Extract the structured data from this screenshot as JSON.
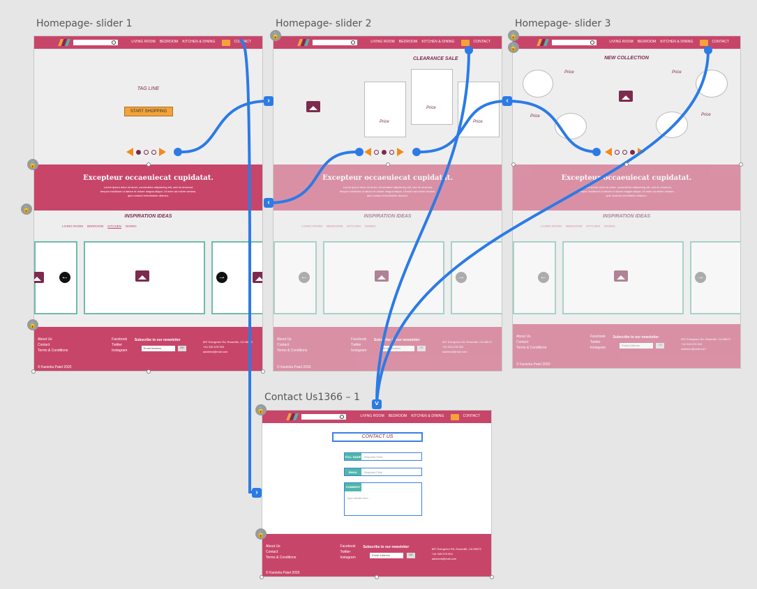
{
  "artboards": [
    {
      "title": "Homepage- slider 1",
      "tagline": "TAG LINE",
      "cta": "START SHOPPING"
    },
    {
      "title": "Homepage- slider 2",
      "heading": "CLEARANCE SALE",
      "price": "Price"
    },
    {
      "title": "Homepage- slider 3",
      "heading": "NEW COLLECTION",
      "price": "Price"
    },
    {
      "title": "Contact Us1366 – 1",
      "heading": "CONTACT US",
      "fields": [
        {
          "label": "FULL NAME",
          "placeholder": "Required Field"
        },
        {
          "label": "EMAIL",
          "placeholder": "Required Field"
        },
        {
          "label": "COMMENT",
          "placeholder": "Type details here..."
        }
      ]
    }
  ],
  "header": {
    "nav": [
      "LIVING ROOM",
      "BEDROOM",
      "KITCHEN & DINING"
    ],
    "contact": "CONTACT"
  },
  "band": {
    "title": "Excepteur occaeuiecat cupidatat.",
    "text": "Lorem ipsum dolor sit amet, consectetur adipisicing elit, sed do eiusmod tempor incididunt ut labore et dolore magna aliqua. Ut enim ad minim veniam, quis nostrud exercitation ullamco."
  },
  "inspiration": {
    "title": "INSPIRATION IDEAS",
    "tabs": [
      "LIVING ROOM",
      "BEDROOM",
      "KITCHEN",
      "DINING"
    ]
  },
  "footer": {
    "links": [
      "About Us",
      "Contact",
      "Terms & Conditions"
    ],
    "social": [
      "Facebook",
      "Twitter",
      "Instagram"
    ],
    "newsletter": "Subscribe to our newsletter",
    "email_placeholder": "Email Address",
    "ok": "OK",
    "address": [
      "897 Evergreen Rd, Roseville, CA 95673",
      "+44 345 678 903",
      "adobexd@mail.com"
    ],
    "copyright": "© Kanisha Patel 2020"
  },
  "colors": {
    "brand": "#c8456a",
    "accent": "#f2a33a",
    "wire": "#2c7be5",
    "teal": "#6fbbaa"
  }
}
